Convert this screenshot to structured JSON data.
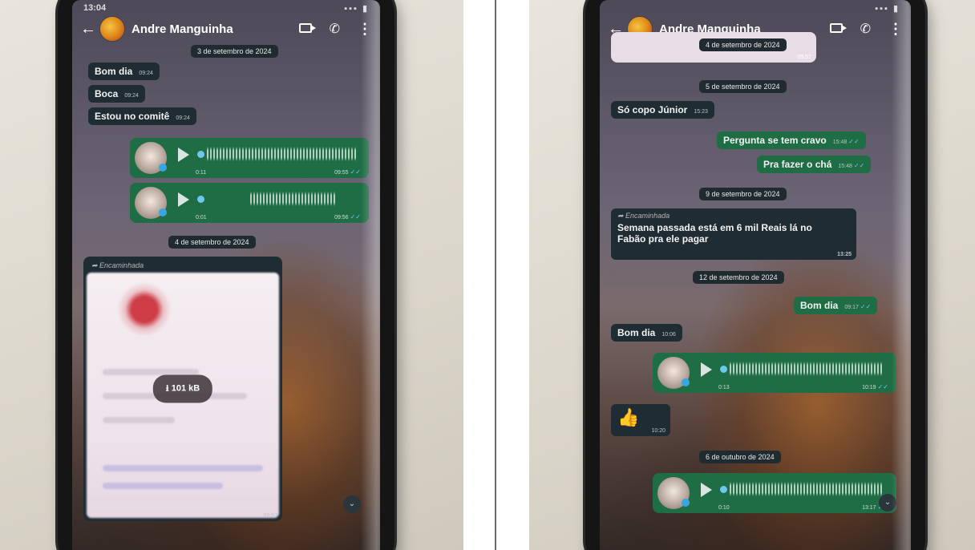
{
  "left": {
    "contact_name": "Andre Manguinha",
    "status_time": "13:04",
    "date_chips": [
      "3 de setembro de 2024",
      "4 de setembro de 2024"
    ],
    "messages": [
      {
        "text": "Bom dia",
        "time": "09:24"
      },
      {
        "text": "Boca",
        "time": "09:24"
      },
      {
        "text": "Estou no comitê",
        "time": "09:24"
      }
    ],
    "voice_notes": [
      {
        "duration": "0:11",
        "time": "09:55"
      },
      {
        "duration": "0:01",
        "time": "09:56"
      }
    ],
    "forwarded_label": "Encaminhada",
    "document": {
      "size": "101 kB",
      "time": "09:57"
    },
    "scroll_icon": "chevron-double-down-icon"
  },
  "right": {
    "contact_name": "Andre Manguinha",
    "date_chips": [
      "4 de setembro de 2024",
      "5 de setembro de 2024",
      "9 de setembro de 2024",
      "12 de setembro de 2024",
      "6 de outubro de 2024"
    ],
    "top_card_time": "09:57",
    "incoming_1": {
      "text": "Só copo Júnior",
      "time": "15:23"
    },
    "outgoing_1": {
      "text": "Pergunta se tem cravo",
      "time": "15:48"
    },
    "outgoing_2": {
      "text": "Pra fazer o chá",
      "time": "15:48"
    },
    "forwarded": {
      "label": "Encaminhada",
      "text_line1": "Semana passada está em 6 mil Reais lá no",
      "text_line2": "Fabão pra ele pagar",
      "time": "13:25"
    },
    "outgoing_3": {
      "text": "Bom dia",
      "time": "09:17"
    },
    "incoming_2": {
      "text": "Bom dia",
      "time": "10:06"
    },
    "voice_note_1": {
      "duration": "0:13",
      "time": "10:19"
    },
    "emoji_reply": {
      "emoji": "👍",
      "time": "10:20"
    },
    "voice_note_2": {
      "duration": "0:10",
      "time": "13:17"
    }
  },
  "colors": {
    "incoming_bubble": "#1f2c33",
    "outgoing_bubble": "#1f6d44",
    "read_ticks": "#6fc7ee",
    "fab": "#25c16a"
  }
}
